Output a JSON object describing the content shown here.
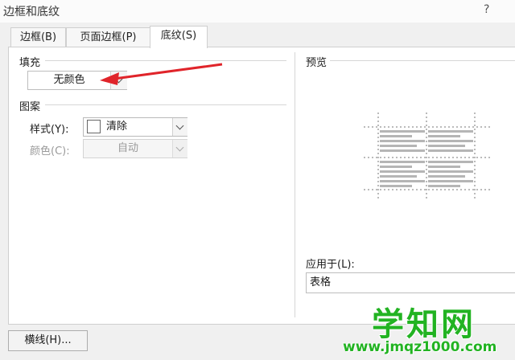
{
  "window": {
    "title": "边框和底纹",
    "help": "?"
  },
  "tabs": [
    {
      "label": "边框(B)",
      "active": false
    },
    {
      "label": "页面边框(P)",
      "active": false
    },
    {
      "label": "底纹(S)",
      "active": true
    }
  ],
  "fill": {
    "label": "填充",
    "value": "无颜色"
  },
  "pattern": {
    "label": "图案",
    "style_label": "样式(Y):",
    "style_value": "清除",
    "color_label": "颜色(C):",
    "color_value": "自动"
  },
  "preview": {
    "label": "预览"
  },
  "apply_to": {
    "label": "应用于(L):",
    "value": "表格"
  },
  "buttons": {
    "horizontal_line": "横线(H)..."
  },
  "watermark": {
    "main": "学知网",
    "url": "www.jmqz1000.com"
  },
  "colors": {
    "accent_arrow": "#e0242a",
    "watermark": "#22b322"
  },
  "icons": {
    "arrow": "red-arrow-annotation",
    "dropdown": "chevron-down-icon",
    "help": "help-icon"
  }
}
